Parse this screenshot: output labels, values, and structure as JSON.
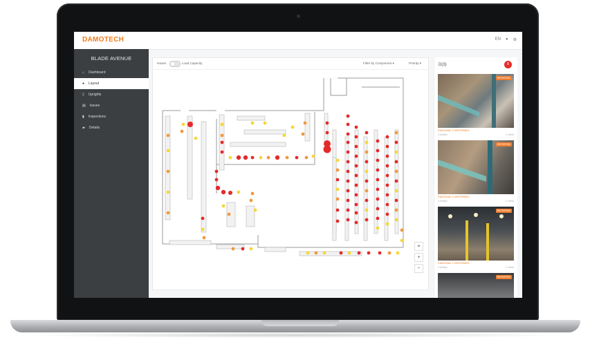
{
  "app": {
    "brand": "DAMOTECH",
    "top_icons": [
      "EN",
      "help-icon",
      "gear-icon"
    ]
  },
  "sidebar": {
    "site_name": "BLADE AVENUE",
    "items": [
      {
        "label": "Dashboard",
        "icon": "home-icon",
        "active": false
      },
      {
        "label": "Layout",
        "icon": "map-pin-icon",
        "active": true
      },
      {
        "label": "Uprights",
        "icon": "upright-icon",
        "active": false
      },
      {
        "label": "Issues",
        "icon": "issues-icon",
        "active": false
      },
      {
        "label": "Inspections",
        "icon": "document-icon",
        "active": false
      },
      {
        "label": "Details",
        "icon": "book-icon",
        "active": false
      }
    ]
  },
  "toolbar": {
    "issues_label": "Issues",
    "load_capacity_label": "Load Capacity",
    "filter_label": "Filter by Component ▾",
    "priority_label": "Priority ▾"
  },
  "zoom": {
    "locate": "⌖",
    "plus": "+",
    "minus": "−"
  },
  "right_panel": {
    "title": "D(3)",
    "count": "8",
    "cards": [
      {
        "tag": "REPORTED",
        "title": "DIAGONAL 1 DEFORMED",
        "meta_left": "3 Details",
        "meta_right": "1 Views"
      },
      {
        "tag": "REPORTED",
        "title": "DIAGONAL 1 DEFORMED",
        "meta_left": "3 Details",
        "meta_right": "1 Views"
      },
      {
        "tag": "REPORTED",
        "title": "DIAGONAL 1 DEFORMED",
        "meta_left": "3 Details",
        "meta_right": "1 Views"
      },
      {
        "tag": "REPORTED",
        "title": "",
        "meta_left": "",
        "meta_right": ""
      }
    ]
  },
  "colors": {
    "brand": "#f07c1e",
    "sidebar": "#3b3f42",
    "issue_high": "#e52a2a",
    "issue_medium": "#f09a3e",
    "issue_low": "#f5d73a"
  }
}
